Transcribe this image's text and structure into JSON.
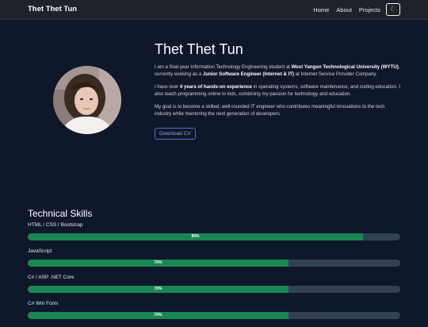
{
  "nav": {
    "brand": "Thet Thet Tun",
    "links": [
      "Home",
      "About",
      "Projects"
    ],
    "theme_icon": "moon-icon"
  },
  "hero": {
    "name": "Thet Thet Tun",
    "p1_a": "I am a final-year Information Technology Engineering student at ",
    "p1_b": "West Yangon Technological University (WYTU)",
    "p1_c": ", currently working as a ",
    "p1_d": "Junior Software Engineer (Internet & IT)",
    "p1_e": " at Internet Service Provider Company.",
    "p2_a": "I have over ",
    "p2_b": "4 years of hands-on experience",
    "p2_c": " in operating systems, software maintenance, and coding education. I also teach programming online to kids, combining my passion for technology and education.",
    "p3": "My goal is to become a skilled, well-rounded IT engineer who contributes meaningful innovations to the tech industry while mentoring the next generation of developers.",
    "cv_button": "Download CV"
  },
  "skills": {
    "heading": "Technical Skills",
    "items": [
      {
        "name": "HTML / CSS / Bootstrap",
        "percent": 90,
        "label": "90%"
      },
      {
        "name": "JavaScript",
        "percent": 70,
        "label": "70%"
      },
      {
        "name": "C# / ASP .NET Core",
        "percent": 70,
        "label": "70%"
      },
      {
        "name": "C# Win Form",
        "percent": 70,
        "label": "70%"
      }
    ]
  },
  "colors": {
    "background": "#0f172a",
    "navbar": "#1e222b",
    "bar_fill": "#198754",
    "bar_track": "#334155",
    "button_accent": "#5b6bbf"
  }
}
